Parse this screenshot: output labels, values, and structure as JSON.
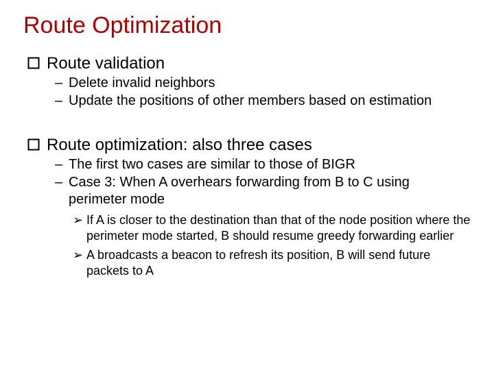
{
  "title": "Route Optimization",
  "sections": [
    {
      "heading": "Route validation",
      "dashes": [
        "Delete invalid neighbors",
        "Update the positions of other members based on estimation"
      ],
      "chevs": []
    },
    {
      "heading": "Route optimization: also three cases",
      "dashes": [
        "The first two cases are similar to those of  BIGR",
        "Case 3:  When A overhears forwarding from B to C using perimeter mode"
      ],
      "chevs": [
        "If A is closer to the destination than that of the node position where the perimeter mode started, B should resume greedy forwarding earlier",
        "A broadcasts a beacon to refresh its position, B will send future  packets to A"
      ]
    }
  ]
}
